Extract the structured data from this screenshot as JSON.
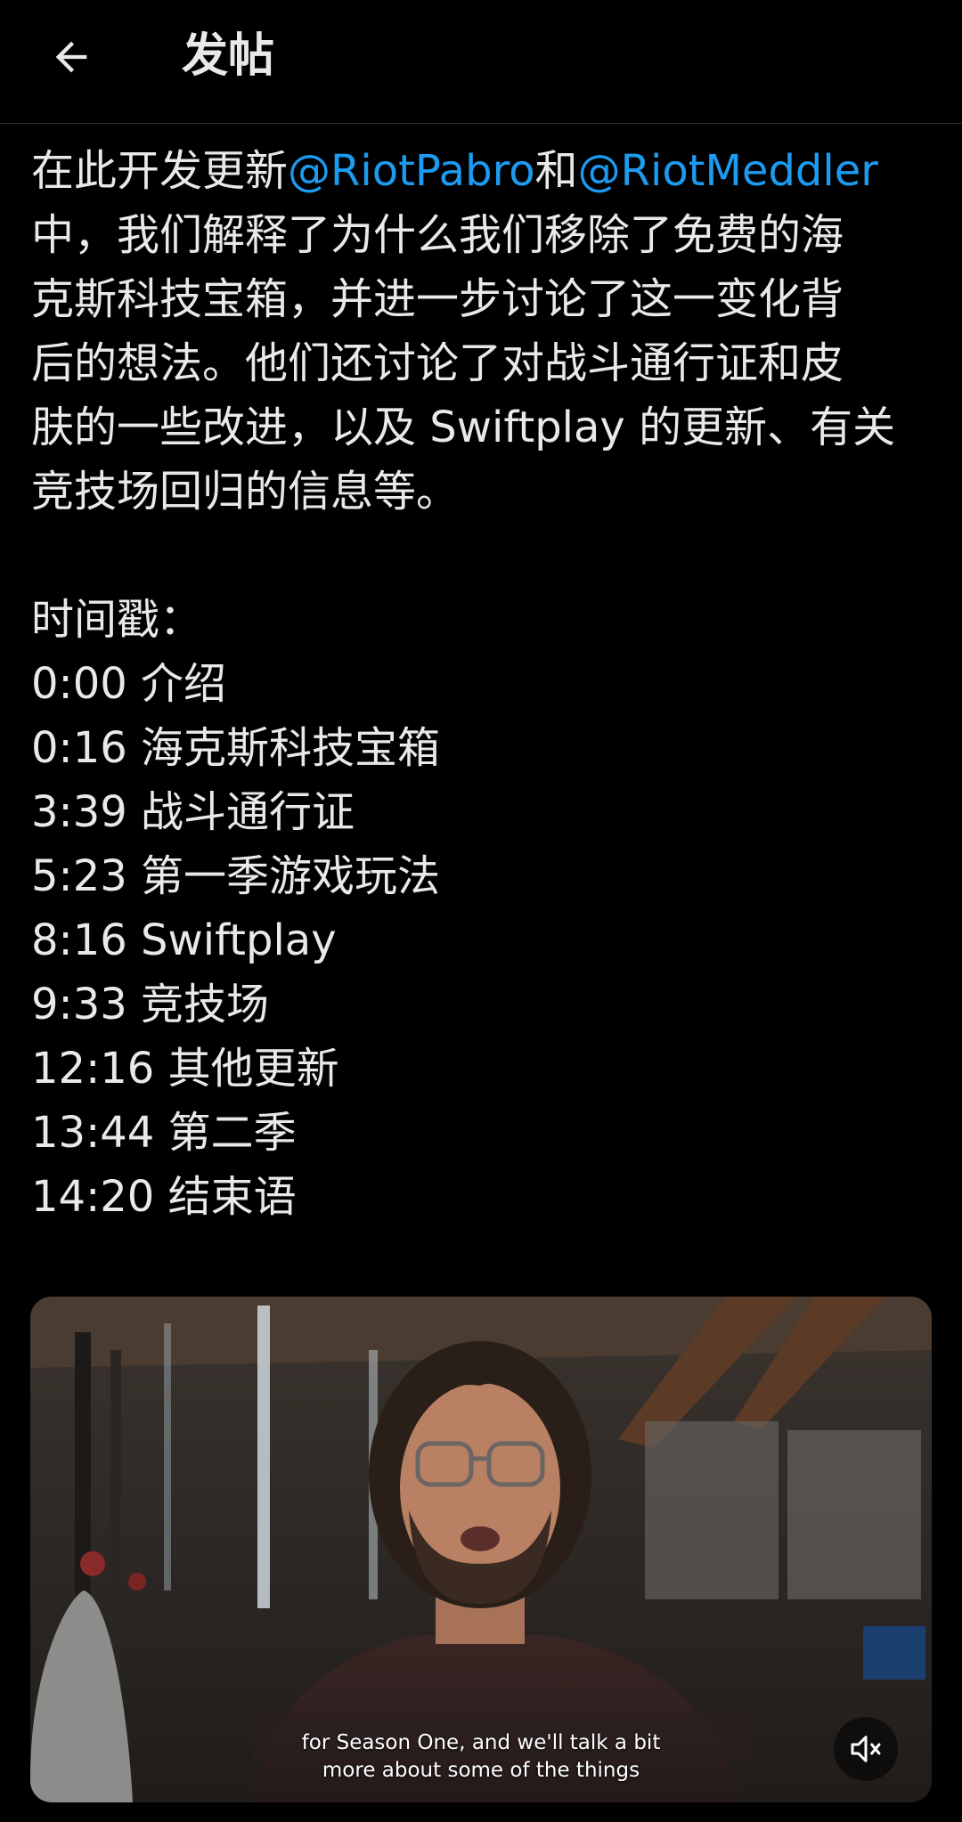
{
  "header": {
    "title": "发帖",
    "back_icon": "arrow-left-icon"
  },
  "post": {
    "line1_text": "在此开发更新",
    "mention1": "@RiotPabro",
    "line1_join": "和",
    "mention2": "@RiotMeddler",
    "lines": [
      "中，我们解释了为什么我们移除了免费的海",
      "克斯科技宝箱，并进一步讨论了这一变化背",
      "后的想法。他们还讨论了对战斗通行证和皮",
      "肤的一些改进，以及 Swiftplay 的更新、有关",
      "竞技场回归的信息等。"
    ],
    "timestamps_heading": "时间戳：",
    "timestamps": [
      "0:00 介绍",
      "0:16 海克斯科技宝箱",
      "3:39 战斗通行证",
      "5:23 第一季游戏玩法",
      "8:16 Swiftplay",
      "9:33 竞技场",
      "12:16 其他更新",
      "13:44 第二季",
      "14:20 结束语"
    ]
  },
  "video": {
    "caption_line1": "for Season One, and we'll talk a bit",
    "caption_line2": "more about some of the things",
    "mute_icon": "muted-speaker-icon"
  },
  "colors": {
    "background": "#000000",
    "text": "#e7e9ea",
    "mention": "#1d9bf0"
  }
}
